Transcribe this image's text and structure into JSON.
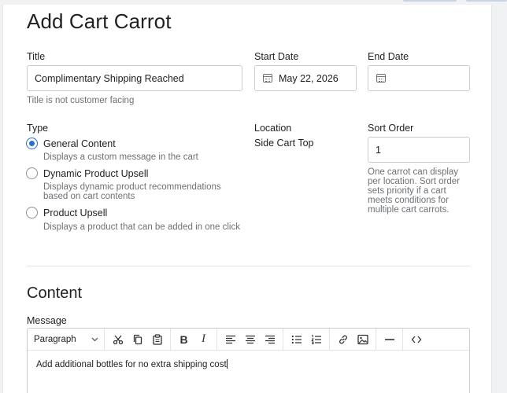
{
  "page": {
    "title": "Add Cart Carrot"
  },
  "fields": {
    "title": {
      "label": "Title",
      "value": "Complimentary Shipping Reached",
      "help": "Title is not customer facing"
    },
    "start_date": {
      "label": "Start Date",
      "value": "May 22, 2026"
    },
    "end_date": {
      "label": "End Date",
      "value": ""
    },
    "type": {
      "label": "Type",
      "options": [
        {
          "label": "General Content",
          "help": "Displays a custom message in the cart",
          "selected": true
        },
        {
          "label": "Dynamic Product Upsell",
          "help_line1": "Displays dynamic product recommendations",
          "help_line2": "based on cart contents",
          "selected": false
        },
        {
          "label": "Product Upsell",
          "help": "Displays a product that can be added in one click",
          "selected": false
        }
      ]
    },
    "location": {
      "label": "Location",
      "value": "Side Cart Top"
    },
    "sort_order": {
      "label": "Sort Order",
      "value": "1",
      "help_lines": [
        "One carrot can display",
        "per location. Sort order",
        "sets priority if a cart",
        "meets conditions for",
        "multiple cart carrots."
      ]
    }
  },
  "content": {
    "heading": "Content",
    "message_label": "Message",
    "toolbar": {
      "format_value": "Paragraph",
      "icons": [
        "cut-icon",
        "copy-icon",
        "paste-icon",
        "bold-icon",
        "italic-icon",
        "align-left-icon",
        "align-center-icon",
        "align-right-icon",
        "bullet-list-icon",
        "numbered-list-icon",
        "link-icon",
        "image-icon",
        "horizontal-rule-icon",
        "source-code-icon"
      ],
      "bold_glyph": "B",
      "italic_glyph": "I",
      "code_glyph": "<>"
    },
    "message_text": "Add additional bottles for no extra shipping cost"
  },
  "colors": {
    "accent": "#2c6ecb",
    "border": "#c9cccf",
    "muted_text": "#6d7175"
  }
}
